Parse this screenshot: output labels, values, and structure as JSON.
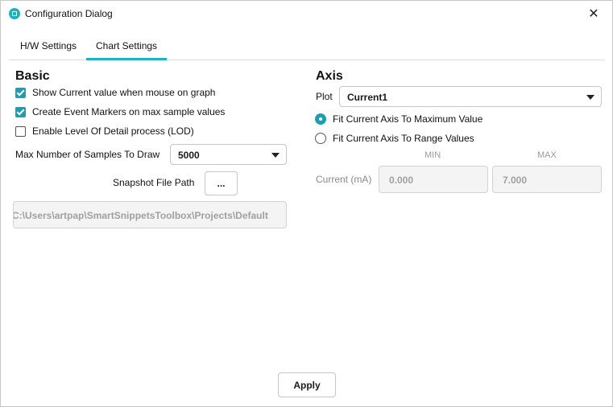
{
  "window": {
    "title": "Configuration Dialog",
    "close_glyph": "✕",
    "icon": "app-icon"
  },
  "tabs": [
    {
      "label": "H/W Settings",
      "active": false
    },
    {
      "label": "Chart Settings",
      "active": true
    }
  ],
  "basic": {
    "title": "Basic",
    "checkboxes": [
      {
        "label": "Show Current value when mouse on graph",
        "checked": true
      },
      {
        "label": "Create Event Markers on max sample values",
        "checked": true
      },
      {
        "label": "Enable Level Of Detail process (LOD)",
        "checked": false
      }
    ],
    "max_samples": {
      "label": "Max Number of Samples To Draw",
      "value": "5000"
    },
    "snapshot": {
      "label": "Snapshot File Path",
      "browse_label": "...",
      "path": "C:\\Users\\artpap\\SmartSnippetsToolbox\\Projects\\Default"
    }
  },
  "axis": {
    "title": "Axis",
    "plot": {
      "label": "Plot",
      "value": "Current1"
    },
    "radios": [
      {
        "label": "Fit Current Axis To Maximum Value",
        "checked": true
      },
      {
        "label": "Fit Current Axis To Range Values",
        "checked": false
      }
    ],
    "range": {
      "min_header": "MIN",
      "max_header": "MAX",
      "row_label": "Current (mA)",
      "min_value": "0.000",
      "max_value": "7.000"
    }
  },
  "footer": {
    "apply_label": "Apply"
  },
  "colors": {
    "accent": "#19a0b4",
    "tab_underline": "#19b4c4"
  }
}
